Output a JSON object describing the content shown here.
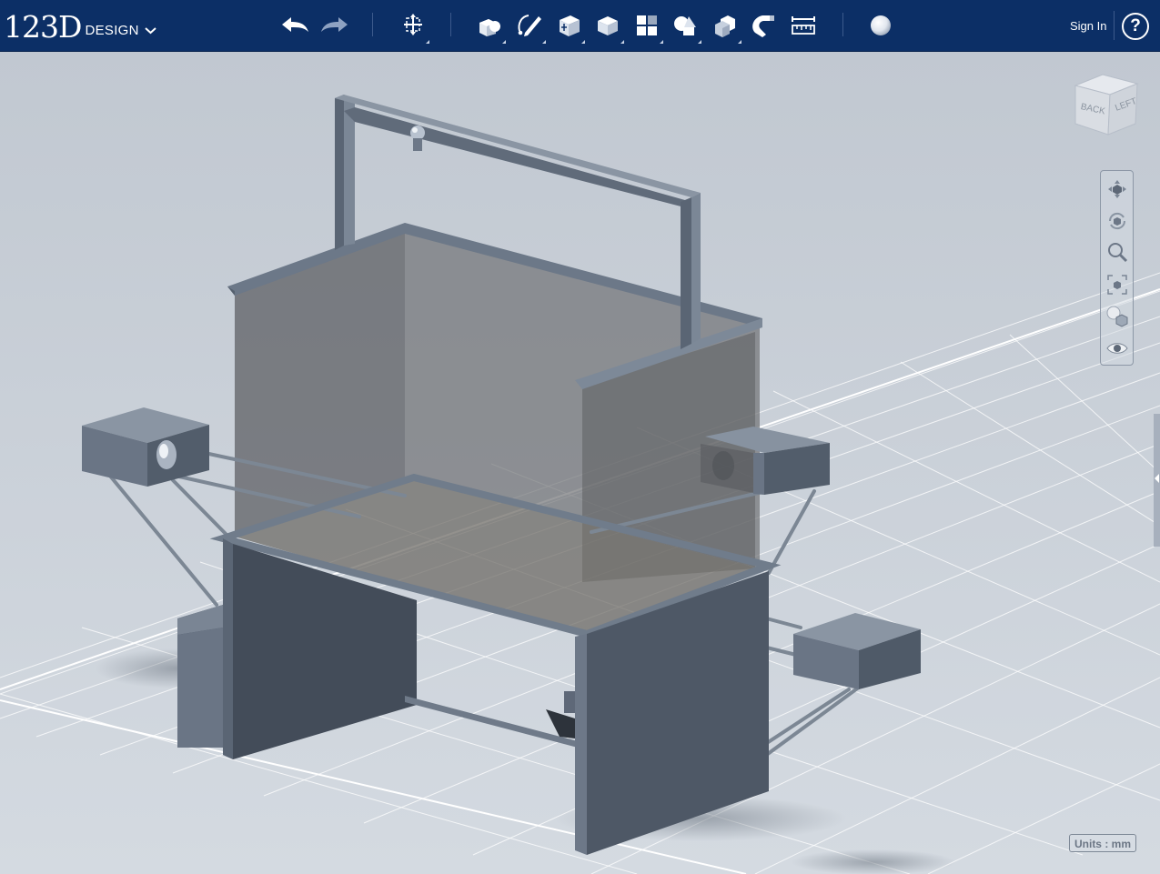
{
  "app": {
    "logo_main": "123D",
    "logo_sub": "DESIGN"
  },
  "toolbar": {
    "undo": "undo-icon",
    "redo": "redo-icon",
    "tools": [
      "transform-icon",
      "primitives-icon",
      "sketch-icon",
      "construct-icon",
      "modify-icon",
      "pattern-icon",
      "grouping-icon",
      "combine-icon",
      "snap-icon",
      "measure-icon",
      "material-icon"
    ],
    "sign_in": "Sign In",
    "help": "?"
  },
  "viewcube": {
    "face_back": "BACK",
    "face_left": "LEFT"
  },
  "navigation": [
    "pan-icon",
    "orbit-icon",
    "zoom-icon",
    "fit-icon",
    "view-style-icon",
    "visibility-icon"
  ],
  "status": {
    "units": "Units : mm"
  },
  "colors": {
    "toolbar_bg": "#0c2f66",
    "viewport_bg": "#c3cad3",
    "model_gray": "#6a7685"
  }
}
